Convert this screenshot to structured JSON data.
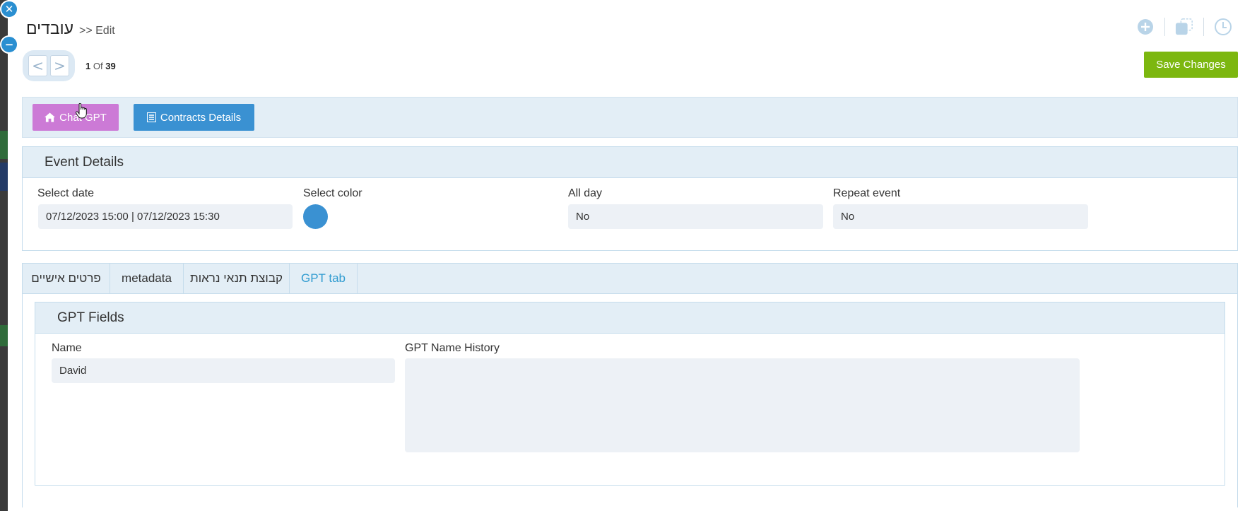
{
  "header": {
    "title": "עובדים",
    "breadcrumb": ">> Edit"
  },
  "pager": {
    "prev": "<",
    "next": ">",
    "current": "1",
    "of_label": "Of",
    "total": "39"
  },
  "actions": {
    "save_label": "Save Changes"
  },
  "toolbar": {
    "chat_gpt_label": "Chat GPT",
    "contracts_label": "Contracts Details"
  },
  "event_details": {
    "title": "Event Details",
    "date_label": "Select date",
    "date_value": "07/12/2023 15:00 | 07/12/2023 15:30",
    "color_label": "Select color",
    "color_value": "#3a91d2",
    "all_day_label": "All day",
    "all_day_value": "No",
    "repeat_label": "Repeat event",
    "repeat_value": "No"
  },
  "tabs": [
    {
      "label": "פרטים אישיים"
    },
    {
      "label": "metadata"
    },
    {
      "label": "קבוצת תנאי נראות"
    },
    {
      "label": "GPT tab"
    }
  ],
  "active_tab": "GPT tab",
  "gpt_fields": {
    "title": "GPT Fields",
    "name_label": "Name",
    "name_value": "David",
    "history_label": "GPT Name History",
    "history_value": ""
  },
  "colors": {
    "accent": "#3a91d2",
    "save": "#7cb70f",
    "chat_button": "#cc7ad6",
    "panel_header": "#e3eef6"
  }
}
